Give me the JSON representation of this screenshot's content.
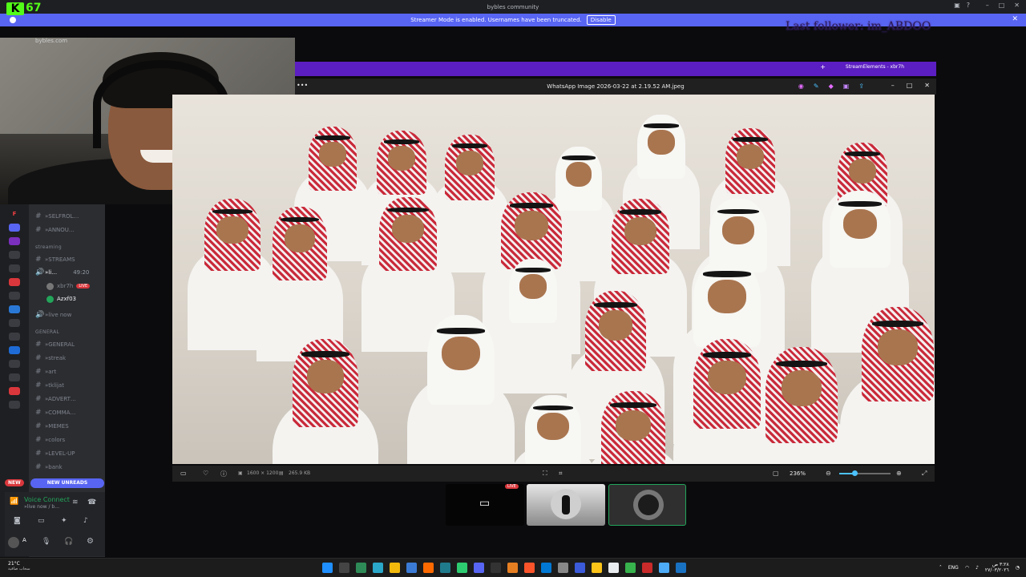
{
  "titlebar": {
    "title": "bybles community"
  },
  "streamer_banner": {
    "message": "Streamer Mode is enabled. Usernames have been truncated.",
    "disable_label": "Disable"
  },
  "overlay": {
    "kick_logo": "K",
    "viewer_count": "67",
    "last_follower": "Last follower: im_ABDOO",
    "webcam_site": "bybles.com"
  },
  "sidebar": {
    "server_letter": "F",
    "channels": [
      {
        "label": "»SELFROL…"
      },
      {
        "label": "»ANNOU…"
      }
    ],
    "cat_streaming": "streaming",
    "stream_channels": [
      {
        "label": "»STREAMS"
      }
    ],
    "voice": {
      "label": "»li…",
      "time": "49:20",
      "members": [
        {
          "name": "xbr7h",
          "badge": "LIVE"
        },
        {
          "name": "Azxf03"
        }
      ],
      "live_now": "»live now"
    },
    "cat_general": "GENERAL",
    "general_channels": [
      {
        "label": "»GENERAL"
      },
      {
        "label": "»streak"
      },
      {
        "label": "»art"
      },
      {
        "label": "»tklijat"
      },
      {
        "label": "»ADVERT…"
      },
      {
        "label": "»COMMA…"
      },
      {
        "label": "»MEMES"
      },
      {
        "label": "»colors"
      },
      {
        "label": "»LEVEL-UP"
      },
      {
        "label": "»bank"
      }
    ],
    "new_label": "NEW",
    "new_unreads": "NEW UNREADS",
    "voice_connected": "Voice Connect",
    "voice_sub": "»live now / b…",
    "user_initial": "A"
  },
  "stream_elements_tab": "StreamElements - xbr7h",
  "viewer": {
    "filename": "WhatsApp Image 2026-03-22 at 2.19.52 AM.jpeg",
    "dimensions": "1600 × 1200",
    "filesize": "265.9 KB",
    "zoom": "236%",
    "zoom_level": 0.3
  },
  "call": {
    "live_badge": "LIVE"
  },
  "taskbar": {
    "temp": "21°C",
    "weather": "سحاب صافية",
    "lang": "ENG",
    "time": "٣:٢٨ ص",
    "date": "٢٧/٠٣/٢٠٢٦"
  },
  "colors": {
    "discord_bg": "#2b2d31",
    "blurple": "#5865f2",
    "live_red": "#da373c",
    "kick_green": "#53fc18",
    "se_purple": "#5b1ec2"
  }
}
